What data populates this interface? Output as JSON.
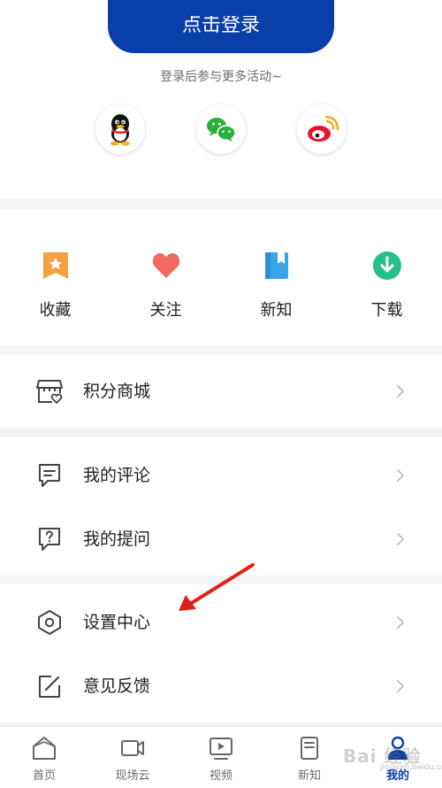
{
  "login": {
    "button_label": "点击登录",
    "hint": "登录后参与更多活动~",
    "social": [
      "qq-icon",
      "wechat-icon",
      "weibo-icon"
    ]
  },
  "quick_actions": [
    {
      "label": "收藏",
      "icon": "bookmark-icon"
    },
    {
      "label": "关注",
      "icon": "heart-icon"
    },
    {
      "label": "新知",
      "icon": "book-icon"
    },
    {
      "label": "下载",
      "icon": "download-icon"
    }
  ],
  "menu": {
    "mall": {
      "label": "积分商城",
      "icon": "store-icon"
    },
    "comments": {
      "label": "我的评论",
      "icon": "comment-icon"
    },
    "questions": {
      "label": "我的提问",
      "icon": "question-icon"
    },
    "settings": {
      "label": "设置中心",
      "icon": "hexagon-settings-icon"
    },
    "feedback": {
      "label": "意见反馈",
      "icon": "edit-icon"
    }
  },
  "bottom_nav": [
    {
      "label": "首页",
      "icon": "home-icon",
      "active": false
    },
    {
      "label": "现场云",
      "icon": "video-camera-icon",
      "active": false
    },
    {
      "label": "视频",
      "icon": "play-icon",
      "active": false
    },
    {
      "label": "新知",
      "icon": "book-icon",
      "active": false
    },
    {
      "label": "我的",
      "icon": "user-icon",
      "active": true
    }
  ],
  "colors": {
    "brand": "#0a3ea8",
    "annotation_arrow": "#e0201a"
  },
  "watermark": {
    "text": "Bai 经验",
    "sub": "jingyan.baidu.com"
  }
}
